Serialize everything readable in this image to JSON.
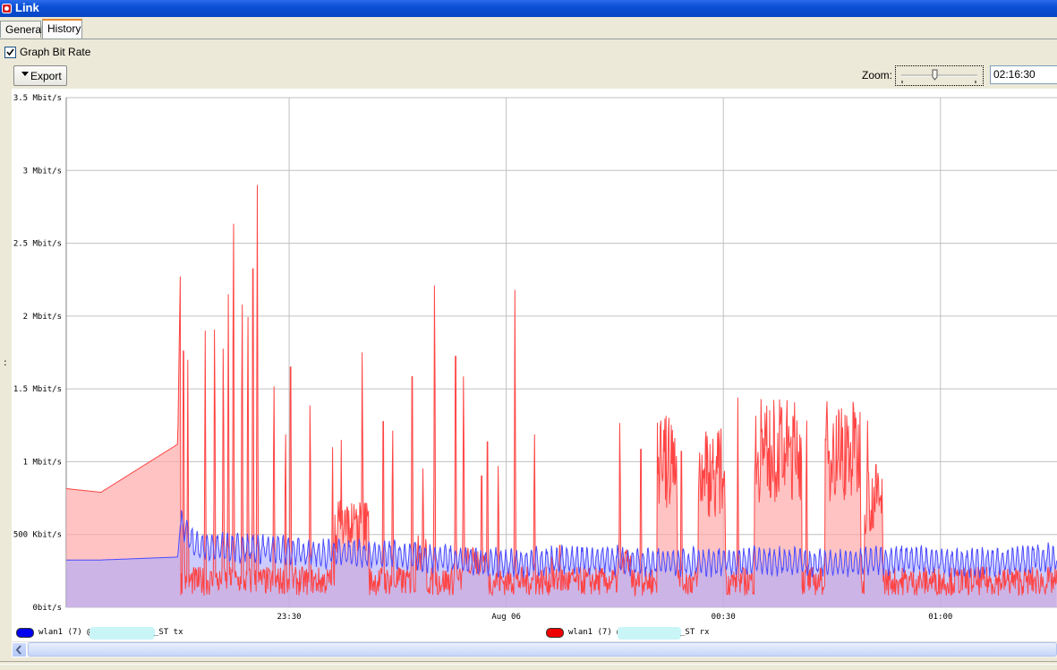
{
  "window": {
    "title": "Link",
    "icon": "app-red-icon"
  },
  "tabs": [
    {
      "label": "General",
      "active": false
    },
    {
      "label": "History",
      "active": true
    }
  ],
  "options": {
    "graph_bit_rate_label": "Graph Bit Rate",
    "graph_bit_rate_checked": true
  },
  "toolbar": {
    "export_label": "Export",
    "zoom_label": "Zoom:",
    "zoom_value": "02:16:30"
  },
  "sidebar": {
    "grip_label": ":"
  },
  "colors": {
    "tx_line": "#4b4bff",
    "tx_fill": "#aaaaff",
    "rx_line": "#ff4444",
    "rx_fill": "#ffaaaa",
    "grid": "#c0c0c0"
  },
  "chart_data": {
    "type": "area",
    "title": "",
    "ylabel": "",
    "xlabel": "",
    "y_unit": "Kbit/s",
    "ylim": [
      0,
      3500
    ],
    "y_tick_labels": [
      "0bit/s",
      "500 Kbit/s",
      "1 Mbit/s",
      "1.5 Mbit/s",
      "2 Mbit/s",
      "2.5 Mbit/s",
      "3 Mbit/s",
      "3.5 Mbit/s"
    ],
    "y_tick_values": [
      0,
      500,
      1000,
      1500,
      2000,
      2500,
      3000,
      3500
    ],
    "x_tick_labels": [
      "23:30",
      "Aug 06",
      "00:30",
      "01:00"
    ],
    "x_tick_minutes": [
      30,
      60,
      90,
      120
    ],
    "xlim_minutes": [
      -0.8,
      136.1
    ],
    "x_unit": "minutes after 23:00",
    "grid": true,
    "legend_position": "bottom",
    "series": [
      {
        "label": "tx",
        "legend_prefix": "wlan1 (7) @",
        "legend_suffix": "_ST tx",
        "color": "#0000ee",
        "base": [
          [
            -0.8,
            325
          ],
          [
            4,
            325
          ],
          [
            14.6,
            345
          ],
          [
            15,
            580
          ],
          [
            17,
            420
          ],
          [
            27,
            400
          ],
          [
            35,
            370
          ],
          [
            45,
            360
          ],
          [
            55,
            320
          ],
          [
            60,
            300
          ],
          [
            70,
            330
          ],
          [
            85,
            310
          ],
          [
            95,
            320
          ],
          [
            105,
            300
          ],
          [
            115,
            330
          ],
          [
            120,
            320
          ],
          [
            125,
            300
          ],
          [
            130,
            330
          ],
          [
            136.1,
            340
          ]
        ],
        "amplitude": 80,
        "period_minutes": 0.7,
        "start_minute": 15
      },
      {
        "label": "rx",
        "legend_prefix": "wlan1 (7) @",
        "legend_suffix": "_ST rx",
        "color": "#ee0000",
        "base": [
          [
            -0.8,
            815
          ],
          [
            4,
            790
          ],
          [
            14.6,
            1120
          ],
          [
            15,
            2400
          ],
          [
            16,
            650
          ],
          [
            136.1,
            100
          ]
        ],
        "spikes": [
          [
            15.4,
            2400
          ],
          [
            16.0,
            1700
          ],
          [
            18.4,
            1900
          ],
          [
            19.7,
            2200
          ],
          [
            20.9,
            2050
          ],
          [
            21.6,
            2150
          ],
          [
            22.3,
            3040
          ],
          [
            23.5,
            2400
          ],
          [
            24.3,
            2300
          ],
          [
            25.0,
            3170
          ],
          [
            25.6,
            2900
          ],
          [
            27.9,
            1750
          ],
          [
            29.5,
            1370
          ],
          [
            30.2,
            2250
          ],
          [
            32.9,
            1600
          ],
          [
            36.0,
            1100
          ],
          [
            37.2,
            1150
          ],
          [
            40.1,
            2020
          ],
          [
            43.0,
            1740
          ],
          [
            44.3,
            1400
          ],
          [
            47.0,
            2160
          ],
          [
            48.5,
            1100
          ],
          [
            50.1,
            2550
          ],
          [
            53.0,
            2350
          ],
          [
            54.1,
            1830
          ],
          [
            56.6,
            1230
          ],
          [
            57.4,
            1550
          ],
          [
            58.9,
            1120
          ],
          [
            61.2,
            2180
          ],
          [
            63.9,
            1370
          ],
          [
            66.3,
            400
          ],
          [
            67.4,
            580
          ],
          [
            71.4,
            360
          ],
          [
            75.7,
            1460
          ],
          [
            78.6,
            1480
          ],
          [
            81.3,
            1430
          ],
          [
            84.2,
            1460
          ],
          [
            86.6,
            1060
          ],
          [
            89.4,
            1440
          ],
          [
            92.0,
            1440
          ],
          [
            95.2,
            1430
          ],
          [
            97.9,
            1060
          ],
          [
            100.2,
            1430
          ],
          [
            101.5,
            1480
          ],
          [
            104.6,
            1460
          ],
          [
            107.5,
            1040
          ],
          [
            109.9,
            1480
          ],
          [
            111.4,
            1200
          ]
        ],
        "plateaus": [
          [
            36.3,
            41.0,
            750
          ],
          [
            47.5,
            49.0,
            500
          ],
          [
            54.1,
            57.2,
            420
          ],
          [
            75.5,
            77.2,
            400
          ],
          [
            80.8,
            83.6,
            1320
          ],
          [
            86.5,
            90.3,
            1240
          ],
          [
            94.3,
            100.8,
            1430
          ],
          [
            104.0,
            109.0,
            1430
          ],
          [
            109.5,
            112.0,
            1000
          ]
        ],
        "noise": 200
      }
    ]
  }
}
